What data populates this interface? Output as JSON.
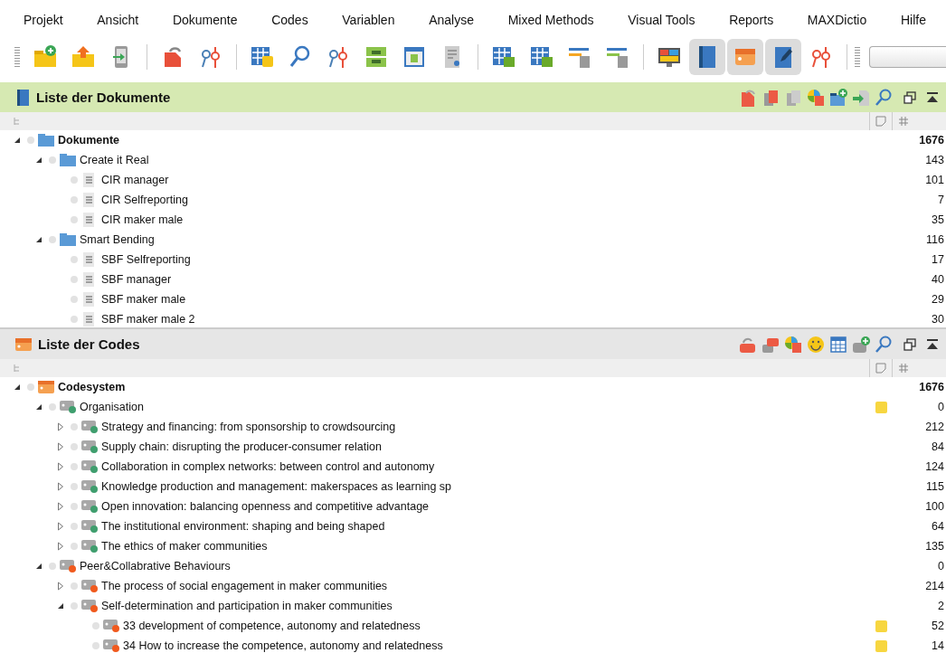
{
  "menu": [
    "Projekt",
    "Ansicht",
    "Dokumente",
    "Codes",
    "Variablen",
    "Analyse",
    "Mixed Methods",
    "Visual Tools",
    "Reports",
    "MAXDictio",
    "Hilfe"
  ],
  "toolbar": [
    [
      {
        "kind": "folder-plus",
        "pressed": false
      },
      {
        "kind": "folder-up",
        "pressed": false
      },
      {
        "kind": "import",
        "pressed": false
      }
    ],
    [
      {
        "kind": "undo-doc",
        "pressed": false
      },
      {
        "kind": "pins-undo",
        "pressed": false
      }
    ],
    [
      {
        "kind": "table-note",
        "pressed": false
      },
      {
        "kind": "search",
        "pressed": false
      },
      {
        "kind": "pins",
        "pressed": false
      },
      {
        "kind": "split",
        "pressed": false
      },
      {
        "kind": "window",
        "pressed": false
      },
      {
        "kind": "list-doc",
        "pressed": false
      }
    ],
    [
      {
        "kind": "table-doc",
        "pressed": false
      },
      {
        "kind": "table-folder",
        "pressed": false
      },
      {
        "kind": "bars",
        "pressed": false
      },
      {
        "kind": "bars-alt",
        "pressed": false
      }
    ],
    [
      {
        "kind": "monitor",
        "pressed": false
      },
      {
        "kind": "document",
        "pressed": true
      },
      {
        "kind": "tag",
        "pressed": true
      },
      {
        "kind": "pen",
        "pressed": true
      },
      {
        "kind": "pins-alt",
        "pressed": false
      }
    ]
  ],
  "documents": {
    "title": "Liste der Dokumente",
    "tree": [
      {
        "name": "Dokumente",
        "kind": "root",
        "count": "1676",
        "expanded": true,
        "children": [
          {
            "name": "Create it Real",
            "kind": "folder",
            "count": "143",
            "expanded": true,
            "children": [
              {
                "name": "CIR manager",
                "kind": "doc",
                "count": "101"
              },
              {
                "name": "CIR Selfreporting",
                "kind": "doc",
                "count": "7"
              },
              {
                "name": "CIR maker male",
                "kind": "doc",
                "count": "35"
              }
            ]
          },
          {
            "name": "Smart Bending",
            "kind": "folder",
            "count": "116",
            "expanded": true,
            "children": [
              {
                "name": "SBF Selfreporting",
                "kind": "doc",
                "count": "17"
              },
              {
                "name": "SBF manager",
                "kind": "doc",
                "count": "40"
              },
              {
                "name": "SBF maker male",
                "kind": "doc",
                "count": "29"
              },
              {
                "name": "SBF maker male 2",
                "kind": "doc",
                "count": "30"
              }
            ]
          }
        ]
      }
    ]
  },
  "codes": {
    "title": "Liste der Codes",
    "tree": [
      {
        "name": "Codesystem",
        "kind": "root",
        "count": "1676",
        "expanded": true,
        "children": [
          {
            "name": "Organisation",
            "kind": "code",
            "color": "#3f9e6e",
            "count": "0",
            "memo": true,
            "expanded": true,
            "children": [
              {
                "name": "Strategy and financing: from sponsorship to crowdsourcing",
                "kind": "code",
                "color": "#3f9e6e",
                "count": "212",
                "memo": false,
                "expanded": false
              },
              {
                "name": "Supply chain: disrupting the producer-consumer relation",
                "kind": "code",
                "color": "#3f9e6e",
                "count": "84",
                "memo": false,
                "expanded": false
              },
              {
                "name": "Collaboration in complex networks: between control and autonomy",
                "kind": "code",
                "color": "#3f9e6e",
                "count": "124",
                "memo": false,
                "expanded": false
              },
              {
                "name": "Knowledge production and management: makerspaces as learning sp",
                "kind": "code",
                "color": "#3f9e6e",
                "count": "115",
                "memo": false,
                "expanded": false
              },
              {
                "name": "Open innovation: balancing openness and competitive advantage",
                "kind": "code",
                "color": "#3f9e6e",
                "count": "100",
                "memo": false,
                "expanded": false
              },
              {
                "name": "The institutional environment: shaping and being shaped",
                "kind": "code",
                "color": "#3f9e6e",
                "count": "64",
                "memo": false,
                "expanded": false
              },
              {
                "name": "The ethics of maker communities",
                "kind": "code",
                "color": "#3f9e6e",
                "count": "135",
                "memo": false,
                "expanded": false
              }
            ]
          },
          {
            "name": "Peer&Collabrative Behaviours",
            "kind": "code",
            "color": "#f05a1e",
            "count": "0",
            "memo": false,
            "expanded": true,
            "children": [
              {
                "name": "The process of social engagement in maker communities",
                "kind": "code",
                "color": "#f05a1e",
                "count": "214",
                "memo": false,
                "expanded": false
              },
              {
                "name": "Self-determination and participation in maker communities",
                "kind": "code",
                "color": "#f05a1e",
                "count": "2",
                "memo": false,
                "expanded": true,
                "children": [
                  {
                    "name": "33 development of competence, autonomy and relatedness",
                    "kind": "code",
                    "color": "#f05a1e",
                    "count": "52",
                    "memo": true
                  },
                  {
                    "name": "34 How to increase the competence, autonomy and relatedness",
                    "kind": "code",
                    "color": "#f05a1e",
                    "count": "14",
                    "memo": true
                  }
                ]
              }
            ]
          }
        ]
      }
    ]
  }
}
